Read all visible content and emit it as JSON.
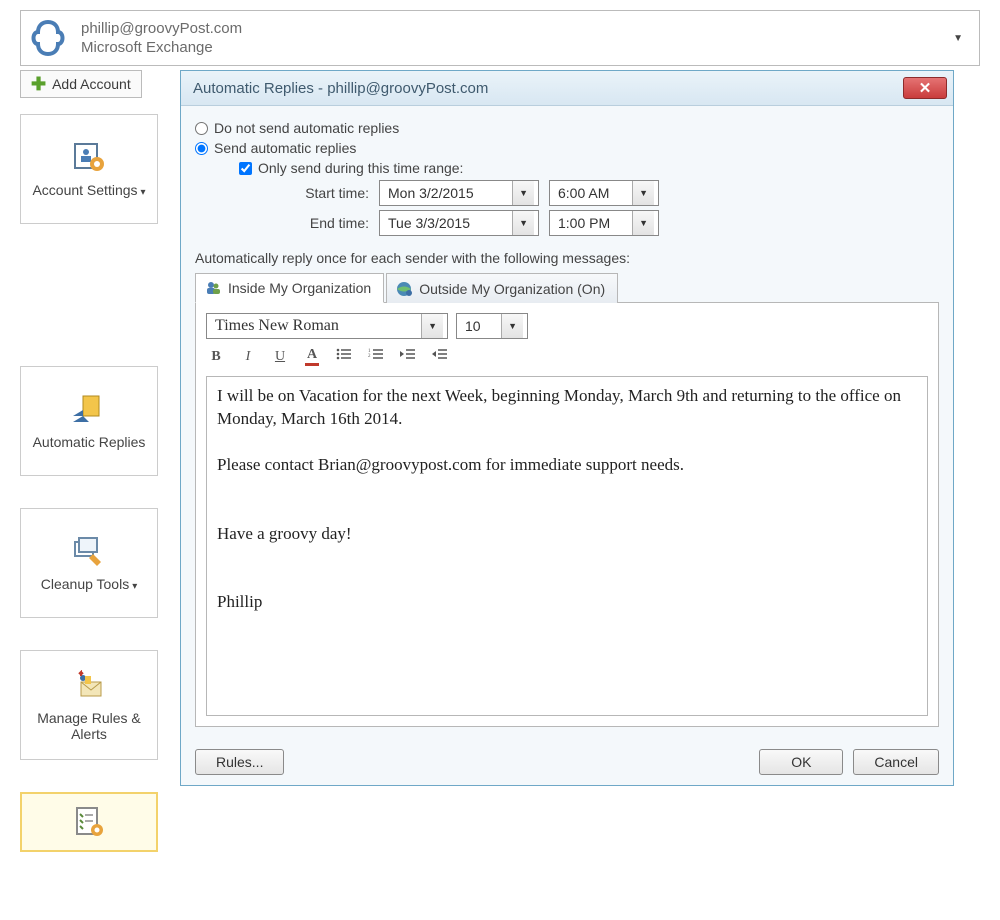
{
  "account": {
    "email": "phillip@groovyPost.com",
    "type": "Microsoft Exchange"
  },
  "sidebar": {
    "add_account": "Add Account",
    "tiles": {
      "account_settings": "Account Settings",
      "automatic_replies": "Automatic Replies",
      "cleanup_tools": "Cleanup Tools",
      "manage_rules": "Manage Rules & Alerts"
    }
  },
  "dialog": {
    "title": "Automatic Replies -  phillip@groovyPost.com",
    "radio_do_not_send": "Do not send automatic replies",
    "radio_send": "Send automatic replies",
    "radio_selected": "send",
    "checkbox_only_range": "Only send during this time range:",
    "checkbox_only_range_checked": true,
    "start_label": "Start time:",
    "end_label": "End time:",
    "start_date": "Mon 3/2/2015",
    "start_time": "6:00 AM",
    "end_date": "Tue 3/3/2015",
    "end_time": "1:00 PM",
    "auto_reply_text": "Automatically reply once for each sender with the following messages:",
    "tabs": {
      "inside": "Inside My Organization",
      "outside": "Outside My Organization (On)"
    },
    "editor": {
      "font_name": "Times New Roman",
      "font_size": "10",
      "body": "I will be on Vacation for the next Week, beginning Monday, March 9th and returning to the office on Monday, March 16th 2014.\n\nPlease contact Brian@groovypost.com for immediate support needs.\n\n\nHave a groovy day!\n\n\nPhillip"
    },
    "buttons": {
      "rules": "Rules...",
      "ok": "OK",
      "cancel": "Cancel"
    }
  }
}
